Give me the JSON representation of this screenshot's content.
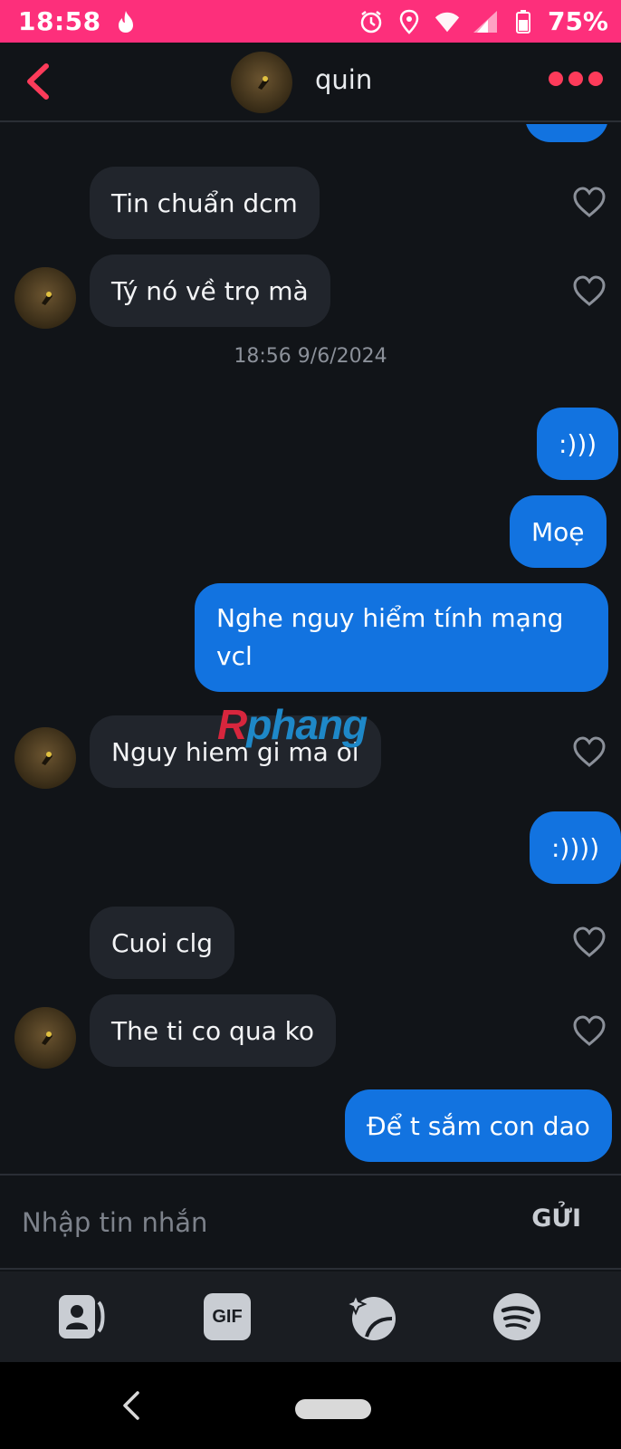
{
  "status_bar": {
    "time": "18:58",
    "battery": "75%",
    "icons": [
      "tinder-flame-icon",
      "alarm-icon",
      "location-icon",
      "wifi-icon",
      "signal-icon",
      "battery-icon"
    ],
    "bg_color": "#fd2f7b"
  },
  "header": {
    "name": "quin",
    "back_icon": "chevron-left-icon",
    "more_icon": "more-dots-icon",
    "accent_color": "#fd3b5a"
  },
  "messages": [
    {
      "id": "m1",
      "dir": "in",
      "text": "Tin chuẩn dcm"
    },
    {
      "id": "m2",
      "dir": "in",
      "text": "Tý nó về trọ mà"
    },
    {
      "id": "ts1",
      "type": "timestamp",
      "text": "18:56 9/6/2024"
    },
    {
      "id": "m3",
      "dir": "out",
      "text": ":)))"
    },
    {
      "id": "m4",
      "dir": "out",
      "text": "Moẹ"
    },
    {
      "id": "m5",
      "dir": "out",
      "text": "Nghe nguy hiểm tính mạng vcl"
    },
    {
      "id": "m6",
      "dir": "in",
      "text": "Nguy hiem gi ma oi"
    },
    {
      "id": "m7",
      "dir": "out",
      "text": ":))))"
    },
    {
      "id": "m8",
      "dir": "in",
      "text": "Cuoi clg"
    },
    {
      "id": "m9",
      "dir": "in",
      "text": "The ti co qua ko"
    },
    {
      "id": "m10",
      "dir": "out",
      "text": "Để t sắm con dao"
    }
  ],
  "watermark": {
    "part1": "R",
    "part2": "phang"
  },
  "composer": {
    "placeholder": "Nhập tin nhắn",
    "send_label": "GỬI"
  },
  "toolbar": {
    "items": [
      "contact-card-icon",
      "gif-icon",
      "sparkle-sticker-icon",
      "spotify-icon"
    ],
    "gif_label": "GIF"
  },
  "colors": {
    "incoming_bubble": "#21252c",
    "outgoing_bubble": "#1273e0",
    "background": "#111418"
  }
}
